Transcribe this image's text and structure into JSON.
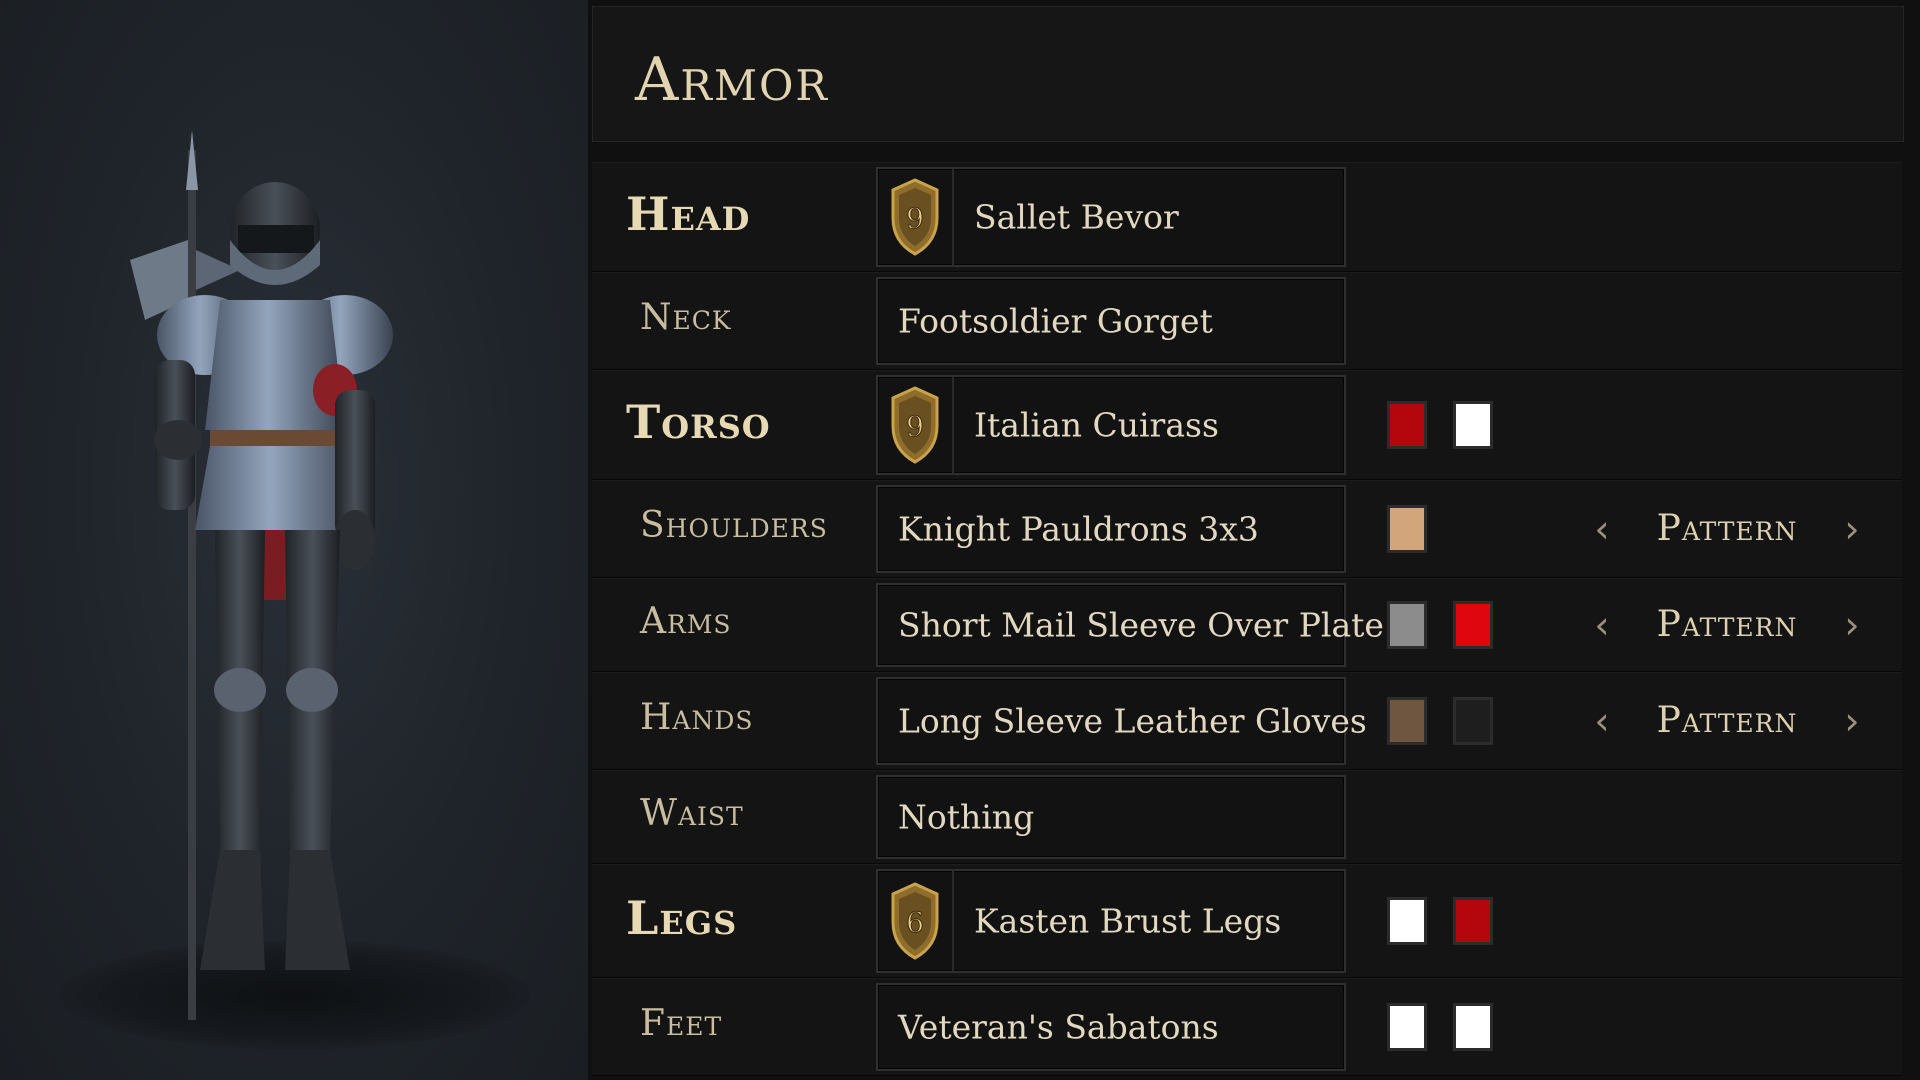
{
  "title": "Armor",
  "slots": [
    {
      "key": "head",
      "label": "Head",
      "major": true,
      "item": "Sallet Bevor",
      "tier": "9",
      "colors": [],
      "pattern": false
    },
    {
      "key": "neck",
      "label": "Neck",
      "major": false,
      "item": "Footsoldier Gorget",
      "tier": null,
      "colors": [],
      "pattern": false
    },
    {
      "key": "torso",
      "label": "Torso",
      "major": true,
      "item": "Italian Cuirass",
      "tier": "9",
      "colors": [
        "#b3060d",
        "#ffffff"
      ],
      "pattern": false
    },
    {
      "key": "shoulders",
      "label": "Shoulders",
      "major": false,
      "item": "Knight Pauldrons 3x3",
      "tier": null,
      "colors": [
        "#d2a57b"
      ],
      "pattern": true
    },
    {
      "key": "arms",
      "label": "Arms",
      "major": false,
      "item": "Short Mail Sleeve Over Plate",
      "tier": null,
      "colors": [
        "#8c8c8c",
        "#e0060f"
      ],
      "pattern": true
    },
    {
      "key": "hands",
      "label": "Hands",
      "major": false,
      "item": "Long Sleeve Leather Gloves",
      "tier": null,
      "colors": [
        "#6f5641",
        "#1e1e1e"
      ],
      "pattern": true
    },
    {
      "key": "waist",
      "label": "Waist",
      "major": false,
      "item": "Nothing",
      "tier": null,
      "colors": [],
      "pattern": false
    },
    {
      "key": "legs",
      "label": "Legs",
      "major": true,
      "item": "Kasten Brust Legs",
      "tier": "6",
      "colors": [
        "#ffffff",
        "#b3060d"
      ],
      "pattern": false
    },
    {
      "key": "feet",
      "label": "Feet",
      "major": false,
      "item": "Veteran's Sabatons",
      "tier": null,
      "colors": [
        "#ffffff",
        "#ffffff"
      ],
      "pattern": false
    }
  ],
  "pattern_label": "Pattern",
  "icons": {
    "tier_badge": "shield-badge-icon",
    "prev": "chevron-left-icon",
    "next": "chevron-right-icon"
  }
}
